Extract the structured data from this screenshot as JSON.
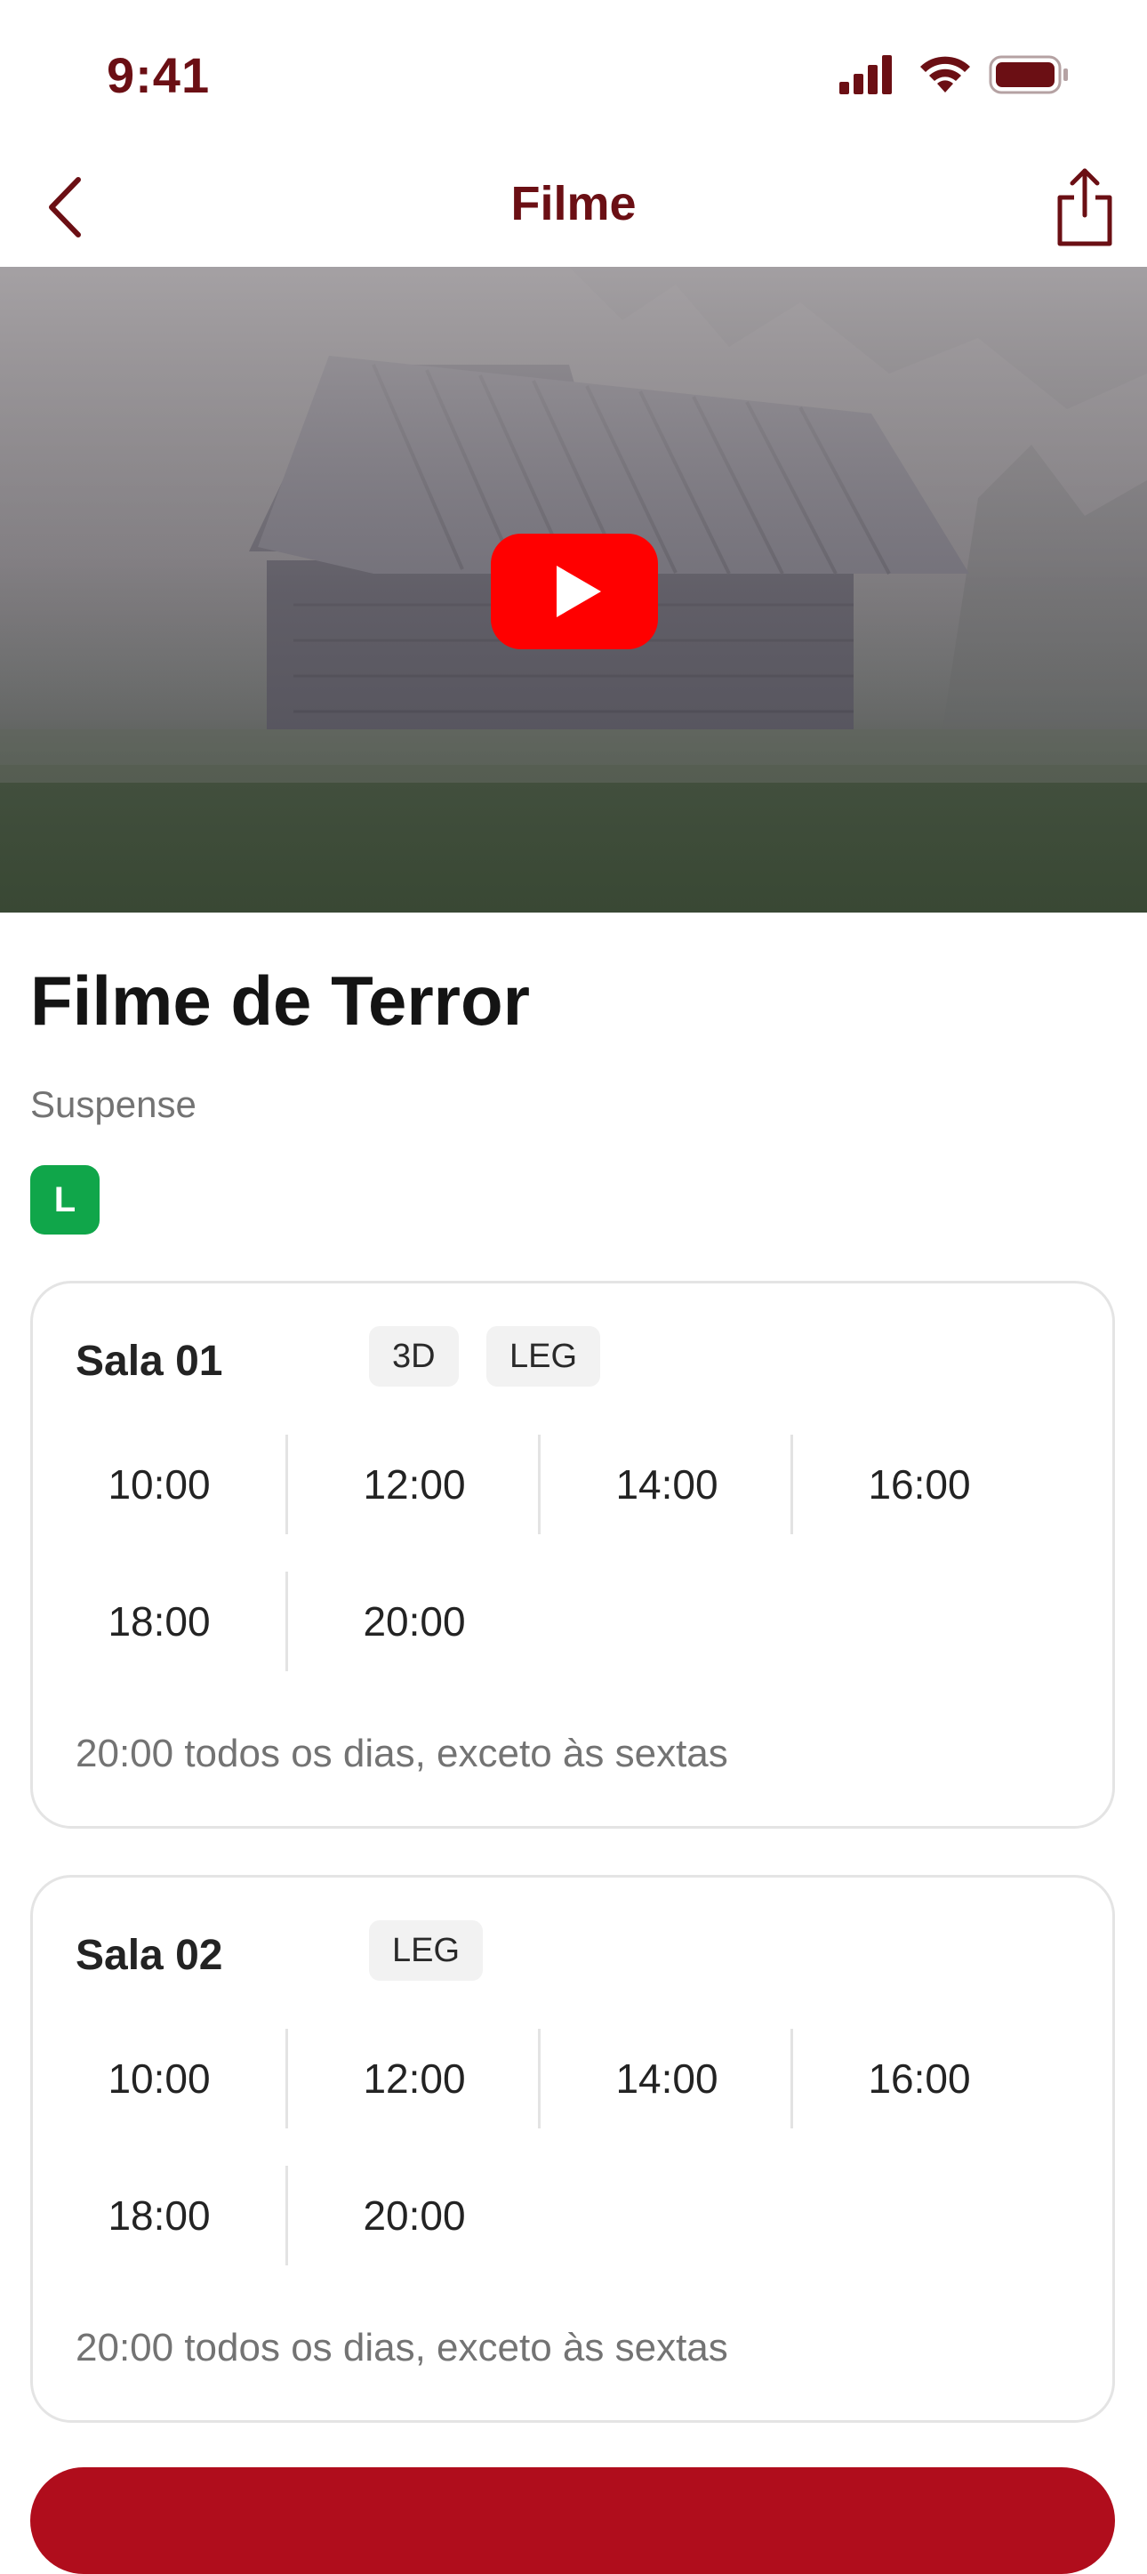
{
  "status_bar": {
    "time": "9:41",
    "icons": [
      "signal-icon",
      "wifi-icon",
      "battery-icon"
    ]
  },
  "nav": {
    "title": "Filme",
    "back_icon": "chevron-left-icon",
    "share_icon": "share-icon"
  },
  "hero": {
    "play_icon": "youtube-play-icon"
  },
  "movie": {
    "title": "Filme de Terror",
    "genre": "Suspense",
    "rating": "L"
  },
  "rooms": [
    {
      "name": "Sala 01",
      "tags": [
        "3D",
        "LEG"
      ],
      "times": [
        "10:00",
        "12:00",
        "14:00",
        "16:00",
        "18:00",
        "20:00"
      ],
      "note": "20:00 todos os dias, exceto às sextas"
    },
    {
      "name": "Sala 02",
      "tags": [
        "LEG"
      ],
      "times": [
        "10:00",
        "12:00",
        "14:00",
        "16:00",
        "18:00",
        "20:00"
      ],
      "note": "20:00 todos os dias, exceto às sextas"
    }
  ],
  "colors": {
    "brand": "#6b0f14",
    "cta": "#b00d1c",
    "rating_green": "#10a64a",
    "youtube_red": "#ff0000"
  }
}
